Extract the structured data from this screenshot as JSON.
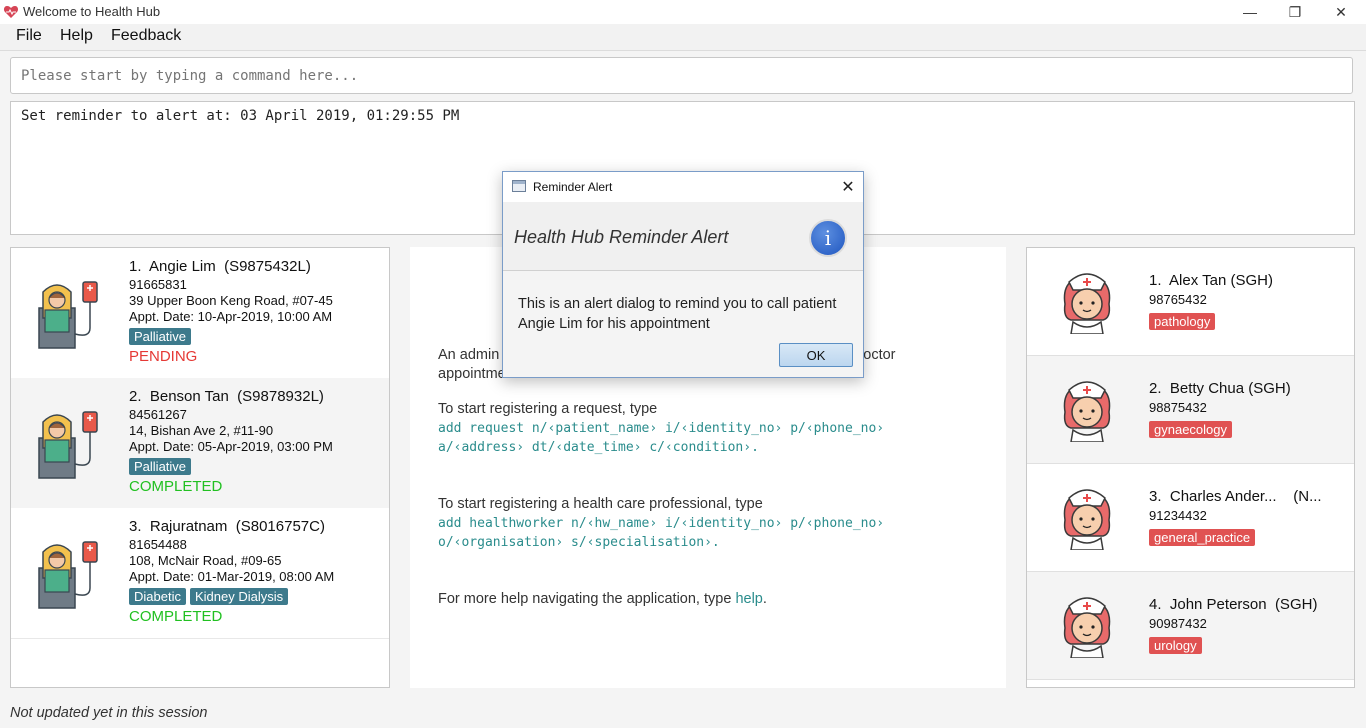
{
  "window": {
    "title": "Welcome to Health Hub",
    "minimize": "—",
    "restore": "❐",
    "close": "✕"
  },
  "menu": {
    "file": "File",
    "help": "Help",
    "feedback": "Feedback"
  },
  "command": {
    "placeholder": "Please start by typing a command here...",
    "value": ""
  },
  "result": {
    "text": "Set reminder to alert at: 03 April 2019, 01:29:55 PM"
  },
  "requests": [
    {
      "index": "1.",
      "name": "Angie Lim",
      "nric": "(S9875432L)",
      "phone": "91665831",
      "address": "39 Upper Boon Keng Road, #07-45",
      "appt": "Appt. Date: 10-Apr-2019, 10:00 AM",
      "tags": [
        "Palliative"
      ],
      "status": "PENDING",
      "status_color": "#e53935"
    },
    {
      "index": "2.",
      "name": "Benson Tan",
      "nric": "(S9878932L)",
      "phone": "84561267",
      "address": "14, Bishan Ave 2, #11-90",
      "appt": "Appt. Date: 05-Apr-2019, 03:00 PM",
      "tags": [
        "Palliative"
      ],
      "status": "COMPLETED",
      "status_color": "#21c021"
    },
    {
      "index": "3.",
      "name": "Rajuratnam",
      "nric": "(S8016757C)",
      "phone": "81654488",
      "address": "108, McNair Road, #09-65",
      "appt": "Appt. Date: 01-Mar-2019, 08:00 AM",
      "tags": [
        "Diabetic",
        "Kidney Dialysis"
      ],
      "status": "COMPLETED",
      "status_color": "#21c021"
    }
  ],
  "tag_color": "#3d7a8c",
  "help": {
    "intro_start": "An admin",
    "intro_end": "octor",
    "intro_line2": "appointments.",
    "request_intro": "To start registering a request, type",
    "request_cmd1": "add request n/‹patient_name› i/‹identity_no› p/‹phone_no›",
    "request_cmd2": "a/‹address› dt/‹date_time› c/‹condition›.",
    "hw_intro": "To start registering a health care professional, type",
    "hw_cmd1": "add healthworker n/‹hw_name› i/‹identity_no› p/‹phone_no›",
    "hw_cmd2": "o/‹organisation› s/‹specialisation›.",
    "more_help_prefix": "For more help navigating the application, type",
    "more_help_link": "help",
    "more_help_suffix": "."
  },
  "healthworkers": [
    {
      "index": "1.",
      "name": "Alex Tan",
      "org": "(SGH)",
      "phone": "98765432",
      "tag": "pathology"
    },
    {
      "index": "2.",
      "name": "Betty Chua",
      "org": "(SGH)",
      "phone": "98875432",
      "tag": "gynaecology"
    },
    {
      "index": "3.",
      "name": "Charles Ander...",
      "org": "(N...",
      "phone": "91234432",
      "tag": "general_practice"
    },
    {
      "index": "4.",
      "name": "John Peterson",
      "org": "(SGH)",
      "phone": "90987432",
      "tag": "urology"
    }
  ],
  "hw_tag_color": "#e05252",
  "status_bar": {
    "text": "Not updated yet in this session"
  },
  "dialog": {
    "title": "Reminder Alert",
    "heading": "Health Hub Reminder Alert",
    "info_icon": "i",
    "message": "This is an alert dialog to remind you to call patient Angie Lim for his appointment",
    "ok": "OK",
    "close": "✕"
  }
}
